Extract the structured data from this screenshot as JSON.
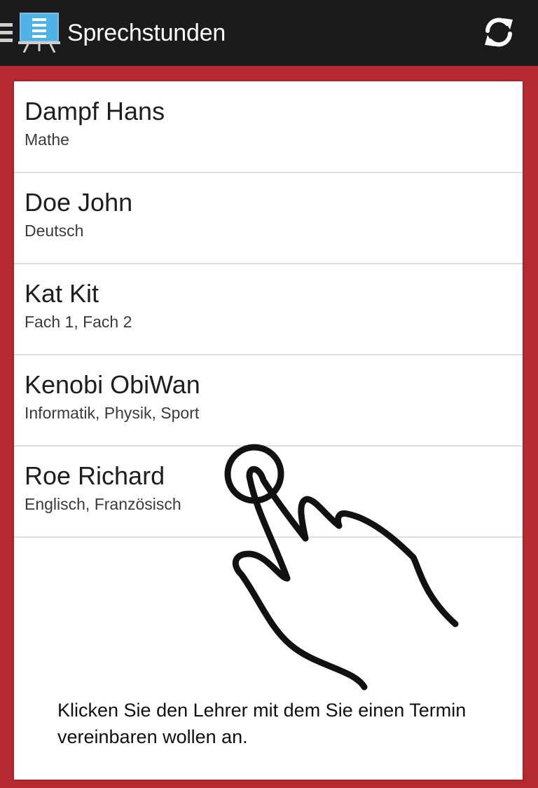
{
  "app": {
    "title": "Sprechstunden",
    "nav_icon": "hamburger-icon",
    "logo_icon": "presentation-board-icon",
    "refresh_icon": "refresh-icon",
    "accent_color": "#b52a31",
    "appbar_color": "#1b1b1b"
  },
  "teachers": [
    {
      "name": "Dampf Hans",
      "subjects": "Mathe"
    },
    {
      "name": "Doe John",
      "subjects": "Deutsch"
    },
    {
      "name": "Kat Kit",
      "subjects": "Fach 1, Fach 2"
    },
    {
      "name": "Kenobi ObiWan",
      "subjects": "Informatik, Physik, Sport"
    },
    {
      "name": "Roe Richard",
      "subjects": "Englisch, Französisch"
    }
  ],
  "overlay": {
    "gesture_icon": "tap-hand-icon",
    "hint": "Klicken Sie den Lehrer mit dem Sie einen Termin vereinbaren wollen an."
  }
}
